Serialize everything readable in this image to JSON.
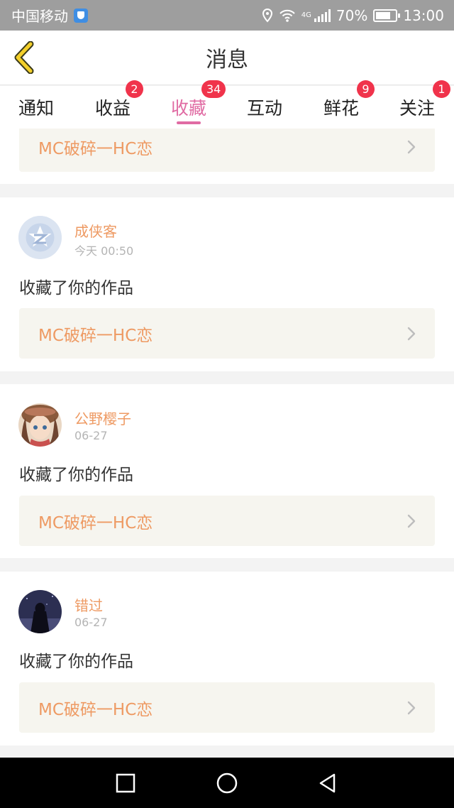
{
  "status_bar": {
    "carrier": "中国移动",
    "network": "4G",
    "battery": "70%",
    "time": "13:00"
  },
  "header": {
    "title": "消息"
  },
  "tabs": [
    {
      "label": "通知",
      "badge": ""
    },
    {
      "label": "收益",
      "badge": "2"
    },
    {
      "label": "收藏",
      "badge": "34",
      "active": true
    },
    {
      "label": "互动",
      "badge": ""
    },
    {
      "label": "鲜花",
      "badge": "9"
    },
    {
      "label": "关注",
      "badge": "1"
    }
  ],
  "colors": {
    "accent": "#e06ba3",
    "badge": "#f0334b",
    "username": "#ee9a63",
    "work_box_bg": "#f6f5ef"
  },
  "partial_item": {
    "work_title": "MC破碎一HC恋"
  },
  "items": [
    {
      "user": "成侠客",
      "time": "今天 00:50",
      "action": "收藏了你的作品",
      "work_title": "MC破碎一HC恋",
      "avatar": "default-qq-avatar"
    },
    {
      "user": "公野樱子",
      "time": "06-27",
      "action": "收藏了你的作品",
      "work_title": "MC破碎一HC恋",
      "avatar": "anime-girl-avatar"
    },
    {
      "user": "错过",
      "time": "06-27",
      "action": "收藏了你的作品",
      "work_title": "MC破碎一HC恋",
      "avatar": "night-silhouette-avatar"
    }
  ]
}
